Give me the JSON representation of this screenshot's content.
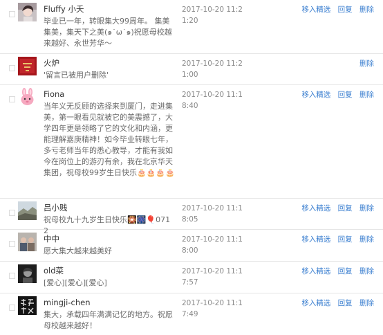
{
  "comments": [
    {
      "name": "Fluffy 小夭",
      "text": "毕业已一年，转眼集大99周年。 集美集美，集天下之美(๑˙ω˙๑)祝愿母校越来越好、永世芳华～",
      "time": "2017-10-20 11:21:20",
      "avatar_icon": "avatar-icon-girl-photo",
      "actions": [
        "移入精选",
        "回复",
        "删除"
      ]
    },
    {
      "name": "火炉",
      "text": "'留言已被用户删除'",
      "time": "2017-10-20 11:21:00",
      "avatar_icon": "avatar-icon-red-poster",
      "actions": [
        "删除"
      ]
    },
    {
      "name": "Fiona",
      "text": "当年义无反顾的选择来到厦门，走进集美，第一眼看见就被它的美震撼了，大学四年更是领略了它的文化和内涵，更能理解嘉庚精神！如今毕业转眼七年，多亏老师当年的悉心教导，才能有我如今在岗位上的游刃有余，我在北京华天集团，祝母校99岁生日快乐🎂🎂🎂🎂",
      "time": "2017-10-20 11:18:40",
      "avatar_icon": "avatar-icon-pink-bunny",
      "actions": [
        "移入精选",
        "回复",
        "删除"
      ]
    },
    {
      "name": "吕小贱",
      "text": "祝母校九十九岁生日快乐🎇🎆🎈0712",
      "time": "2017-10-20 11:18:05",
      "avatar_icon": "avatar-icon-landscape",
      "actions": [
        "移入精选",
        "回复",
        "删除"
      ]
    },
    {
      "name": "中中",
      "text": "愿大集大越来越美好",
      "time": "2017-10-20 11:18:00",
      "avatar_icon": "avatar-icon-group-photo",
      "actions": [
        "移入精选",
        "回复",
        "删除"
      ]
    },
    {
      "name": "old菜",
      "text": "[爱心][爱心][爱心]",
      "time": "2017-10-20 11:17:57",
      "avatar_icon": "avatar-icon-dark-portrait",
      "actions": [
        "移入精选",
        "回复",
        "删除"
      ]
    },
    {
      "name": "mingji-chen",
      "text": "集大，承载四年满满记忆的地方。祝愿母校越来越好！",
      "time": "2017-10-20 11:17:49",
      "avatar_icon": "avatar-icon-calligraphy",
      "actions": [
        "移入精选",
        "回复",
        "删除"
      ]
    }
  ],
  "colors": {
    "link": "#3b7fd0",
    "name": "#333333",
    "text": "#6a6a6a",
    "time": "#8a8a8a",
    "divider": "#e6e6e6"
  }
}
